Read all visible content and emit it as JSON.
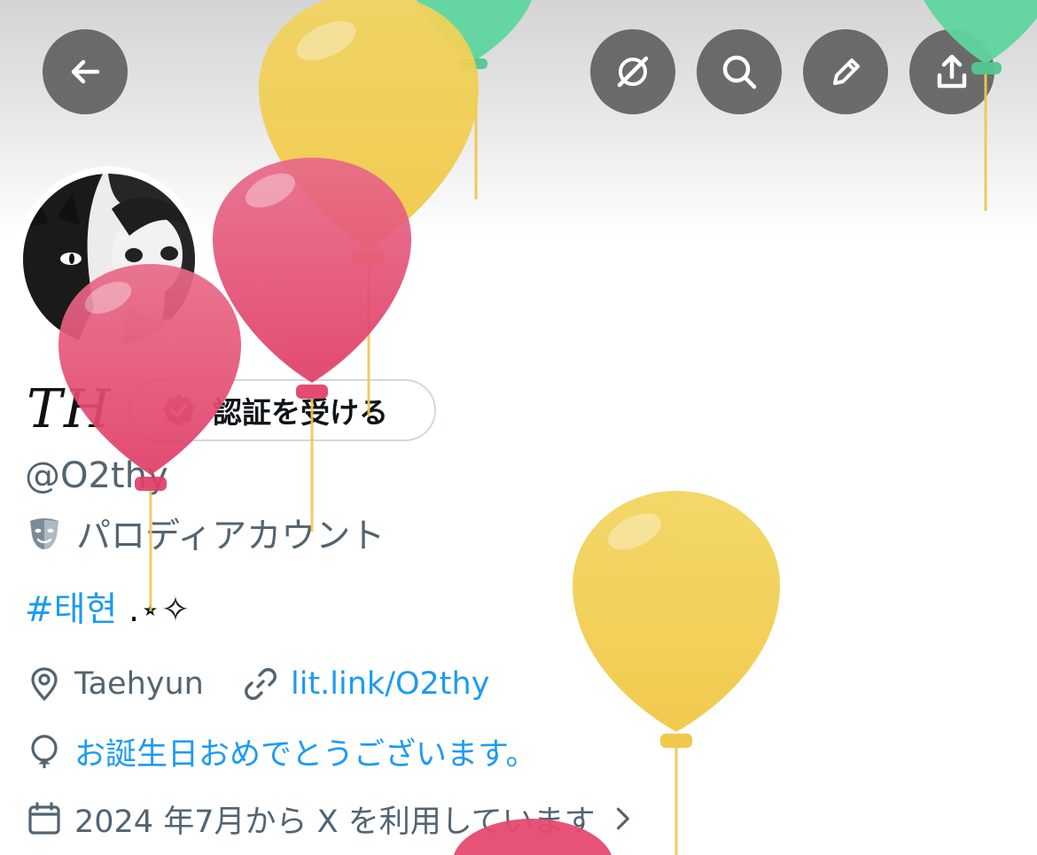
{
  "profile": {
    "display_name": "TH",
    "handle": "@O2thy",
    "verify_label": "認証を受ける",
    "parody_label": "パロディアカウント",
    "bio_hashtag": "#태현",
    "bio_suffix": " .⋆✧",
    "location": "Taehyun",
    "website": "lit.link/O2thy",
    "birthday_text": "お誕生日おめでとうございます。",
    "joined_text": "2024 年7月から X を利用しています"
  },
  "icons": {
    "back": "back-arrow-icon",
    "grok": "grok-icon",
    "search": "search-icon",
    "edit": "pencil-icon",
    "share": "share-icon",
    "verified": "verified-badge-icon",
    "parody": "theater-mask-icon",
    "location": "location-pin-icon",
    "link": "link-icon",
    "birthday": "balloon-icon",
    "calendar": "calendar-icon",
    "chevron": "chevron-right-icon"
  },
  "colors": {
    "link": "#1d9bf0",
    "secondary_text": "#536471",
    "primary_text": "#0f1419",
    "balloon_pink": "#e54a6f",
    "balloon_yellow": "#f2cf52",
    "balloon_green": "#5fd6a0"
  }
}
